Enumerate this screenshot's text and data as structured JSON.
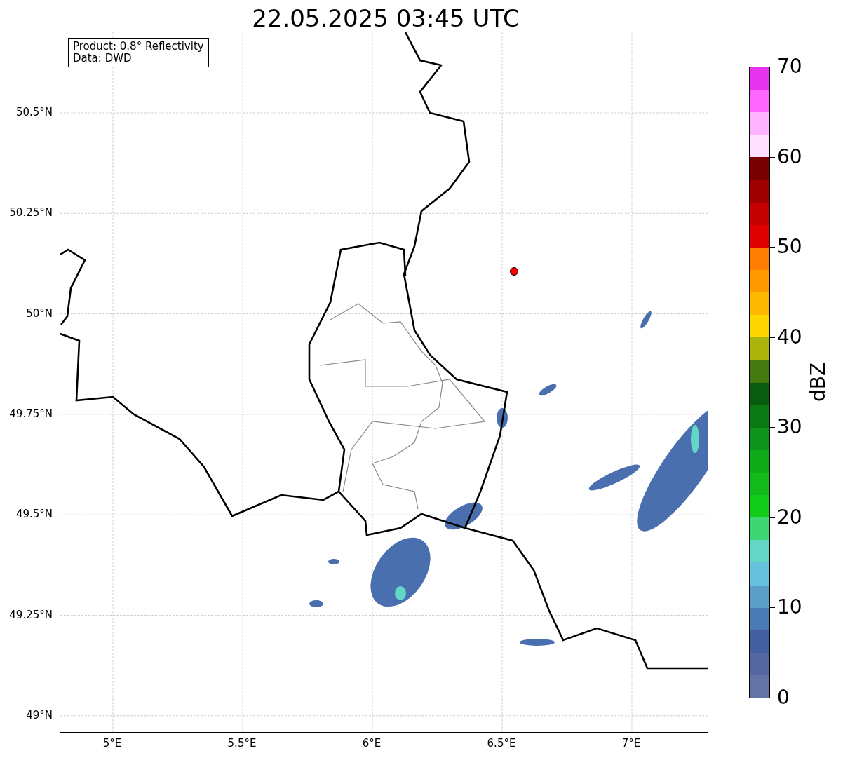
{
  "title": "22.05.2025 03:45 UTC",
  "info_box": {
    "lines": [
      "Product: 0.8° Reflectivity",
      "Data: DWD"
    ]
  },
  "map": {
    "lat_ticks": [
      "50.5°N",
      "50.25°N",
      "50°N",
      "49.75°N",
      "49.5°N",
      "49.25°N",
      "49°N"
    ],
    "lon_ticks": [
      "5°E",
      "5.5°E",
      "6°E",
      "6.5°E",
      "7°E"
    ],
    "marker": {
      "color": "#ff0000"
    }
  },
  "colorbar": {
    "label": "dBZ",
    "ticks": [
      "70",
      "60",
      "50",
      "40",
      "30",
      "20",
      "10",
      "0"
    ],
    "segments": [
      {
        "color": "#6373a6"
      },
      {
        "color": "#5466a0"
      },
      {
        "color": "#445ea2"
      },
      {
        "color": "#4b7bb5"
      },
      {
        "color": "#5a9fc8"
      },
      {
        "color": "#66c2dc"
      },
      {
        "color": "#63d6c6"
      },
      {
        "color": "#3ed672"
      },
      {
        "color": "#12cc1a"
      },
      {
        "color": "#12bb1a"
      },
      {
        "color": "#10aa18"
      },
      {
        "color": "#0e941a"
      },
      {
        "color": "#0b7a14"
      },
      {
        "color": "#085c10"
      },
      {
        "color": "#457a10"
      },
      {
        "color": "#aab40a"
      },
      {
        "color": "#ffd700"
      },
      {
        "color": "#ffb800"
      },
      {
        "color": "#ff9900"
      },
      {
        "color": "#ff7d00"
      },
      {
        "color": "#e00000"
      },
      {
        "color": "#c40000"
      },
      {
        "color": "#a00000"
      },
      {
        "color": "#780000"
      },
      {
        "color": "#ffe0ff"
      },
      {
        "color": "#ffb3ff"
      },
      {
        "color": "#ff66ff"
      },
      {
        "color": "#e633ee"
      }
    ]
  }
}
